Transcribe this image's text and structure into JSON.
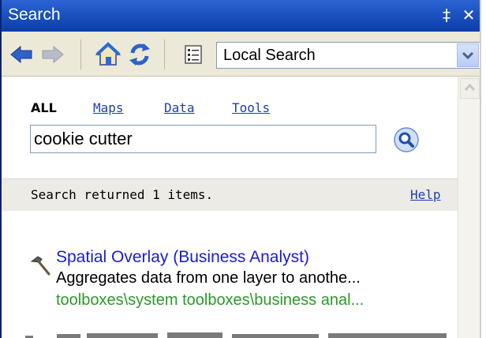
{
  "window": {
    "title": "Search",
    "pin_glyph": "‡",
    "close_glyph": "✕"
  },
  "toolbar": {
    "icons": [
      "back-arrow-icon",
      "forward-arrow-icon",
      "home-icon",
      "refresh-icon",
      "options-icon"
    ],
    "scope_value": "Local Search"
  },
  "tabs": [
    {
      "label": "ALL",
      "active": true
    },
    {
      "label": "Maps",
      "active": false
    },
    {
      "label": "Data",
      "active": false
    },
    {
      "label": "Tools",
      "active": false
    }
  ],
  "search": {
    "value": "cookie cutter"
  },
  "status": {
    "message": "Search returned 1 items.",
    "help_label": "Help"
  },
  "results": [
    {
      "icon": "hammer-icon",
      "title": "Spatial Overlay (Business Analyst)",
      "description": "Aggregates data from one layer to anothe...",
      "path": "toolboxes\\system toolboxes\\business anal..."
    }
  ],
  "colors": {
    "titlebar": "#0a3ea8",
    "link": "#1f3faf",
    "result_title": "#1a1adc",
    "result_path": "#2a9a2a"
  }
}
